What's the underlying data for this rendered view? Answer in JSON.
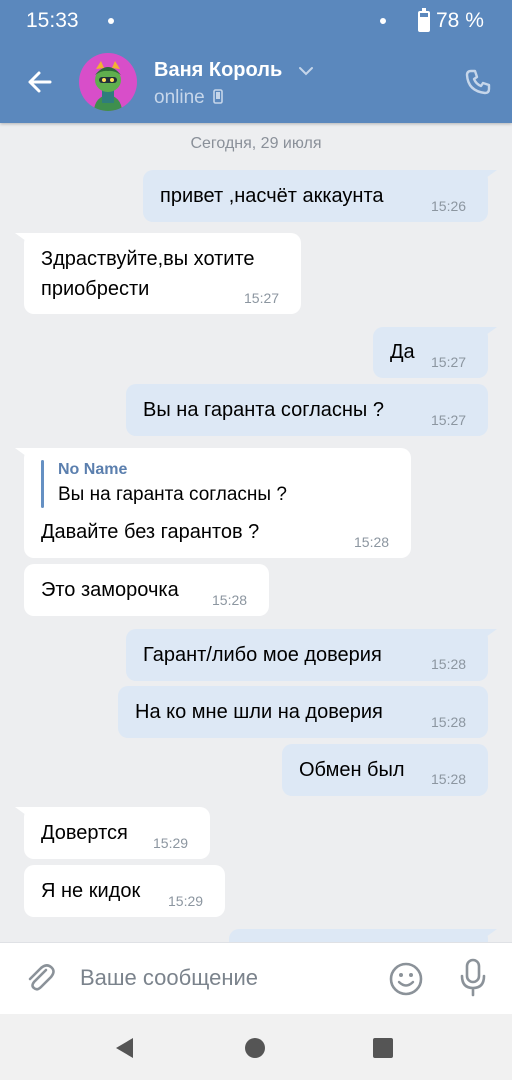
{
  "status_bar": {
    "time": "15:33",
    "battery_percent": "78 %",
    "battery_level": 0.78
  },
  "header": {
    "contact_name": "Ваня Король",
    "contact_status": "online"
  },
  "chat": {
    "date_separator": "Сегодня, 29 июля",
    "messages": [
      {
        "direction": "out",
        "text": "привет ,насчёт аккаунта",
        "time": "15:26"
      },
      {
        "direction": "in",
        "text_line1": "Здраствуйте,вы хотите",
        "text_line2": "приобрести",
        "time": "15:27"
      },
      {
        "direction": "out",
        "text": "Да",
        "time": "15:27"
      },
      {
        "direction": "out",
        "text": "Вы на гаранта согласны ?",
        "time": "15:27"
      },
      {
        "direction": "in",
        "reply_name": "No Name",
        "reply_text": "Вы на гаранта согласны ?",
        "text": "Давайте без гарантов ?",
        "time": "15:28"
      },
      {
        "direction": "in",
        "text": "Это заморочка",
        "time": "15:28"
      },
      {
        "direction": "out",
        "text": "Гарант/либо мое доверия",
        "time": "15:28"
      },
      {
        "direction": "out",
        "text": "На ко мне шли на доверия",
        "time": "15:28"
      },
      {
        "direction": "out",
        "text": "Обмен был",
        "time": "15:28"
      },
      {
        "direction": "in",
        "text": "Довертся",
        "time": "15:29"
      },
      {
        "direction": "in",
        "text": "Я не кидок",
        "time": "15:29"
      }
    ]
  },
  "composer": {
    "placeholder": "Ваше сообщение"
  },
  "icons": {
    "back": "arrow-left-icon",
    "chevron": "chevron-down-icon",
    "device": "phone-device-icon",
    "call": "phone-call-icon",
    "attach": "paperclip-icon",
    "emoji": "smiley-icon",
    "mic": "microphone-icon",
    "nav_back": "triangle-back-icon",
    "nav_home": "circle-home-icon",
    "nav_recent": "square-recent-icon"
  },
  "colors": {
    "header": "#5b88bd",
    "background": "#edeef0",
    "incoming_bubble": "#ffffff",
    "outgoing_bubble": "#dde8f5",
    "avatar": "#d84ec9"
  }
}
